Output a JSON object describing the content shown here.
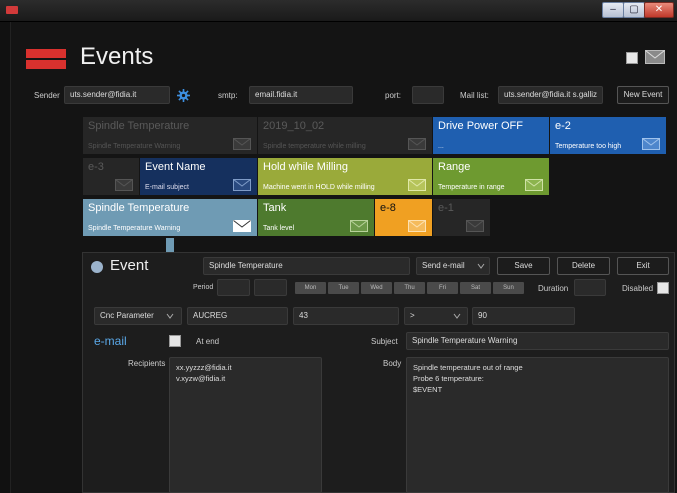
{
  "window": {
    "minimize": "–",
    "maximize": "▢",
    "close": "✕"
  },
  "header": {
    "title": "Events"
  },
  "settings": {
    "sender_label": "Sender",
    "sender_value": "uts.sender@fidia.it",
    "smtp_label": "smtp:",
    "smtp_value": "email.fidia.it",
    "port_label": "port:",
    "port_value": "",
    "maillist_label": "Mail list:",
    "maillist_value": "uts.sender@fidia.it s.galliz",
    "new_event_label": "New Event"
  },
  "events": [
    {
      "title": "Spindle Temperature",
      "subtitle": "Spindle Temperature Warning",
      "style": "dim"
    },
    {
      "title": "2019_10_02",
      "subtitle": "Spindle temperature while milling",
      "style": "dim"
    },
    {
      "title": "Drive Power OFF",
      "subtitle": "...",
      "style": "blue"
    },
    {
      "title": "e-2",
      "subtitle": "Temperature too high",
      "style": "blue"
    },
    {
      "title": "e-3",
      "subtitle": "",
      "style": "dim"
    },
    {
      "title": "Event Name",
      "subtitle": "E-mail subject",
      "style": "navy"
    },
    {
      "title": "Hold while Milling",
      "subtitle": "Machine went in HOLD while milling",
      "style": "olive"
    },
    {
      "title": "Range",
      "subtitle": "Temperature in range",
      "style": "green"
    },
    {
      "title": "Spindle Temperature",
      "subtitle": "Spindle Temperature Warning",
      "style": "steel"
    },
    {
      "title": "Tank",
      "subtitle": "Tank level",
      "style": "darkgreen"
    },
    {
      "title": "e-8",
      "subtitle": "",
      "style": "orange"
    },
    {
      "title": "e-1",
      "subtitle": "",
      "style": "dim"
    }
  ],
  "editor": {
    "heading": "Event",
    "name_value": "Spindle Temperature",
    "action_value": "Send e-mail",
    "save_label": "Save",
    "delete_label": "Delete",
    "exit_label": "Exit",
    "period_label": "Period",
    "days": [
      "Mon",
      "Tue",
      "Wed",
      "Thu",
      "Fri",
      "Sat",
      "Sun"
    ],
    "duration_label": "Duration",
    "disabled_label": "Disabled",
    "source_value": "Cnc Parameter",
    "parameter_value": "AUCREG",
    "index_value": "43",
    "operator_value": ">",
    "threshold_value": "90",
    "email_heading": "e-mail",
    "at_end_label": "At end",
    "subject_label": "Subject",
    "subject_value": "Spindle Temperature Warning",
    "recipients_label": "Recipients",
    "recipients": [
      "xx.yyzzz@fidia.it",
      "v.xyzw@fidia.it"
    ],
    "body_label": "Body",
    "body_lines": [
      "Spindle temperature out of range",
      "Probe 6 temperature:",
      "$EVENT"
    ]
  },
  "colors": {
    "blue": "#1f5fb0",
    "navy": "#15305e",
    "olive": "#9aaa3a",
    "green": "#6e9a30",
    "steel": "#6f9bb4",
    "darkgreen": "#4e7a2e",
    "orange": "#f0a022",
    "dim": "#262626",
    "accent_red": "#d8312e",
    "email_blue": "#5aa8e8"
  }
}
